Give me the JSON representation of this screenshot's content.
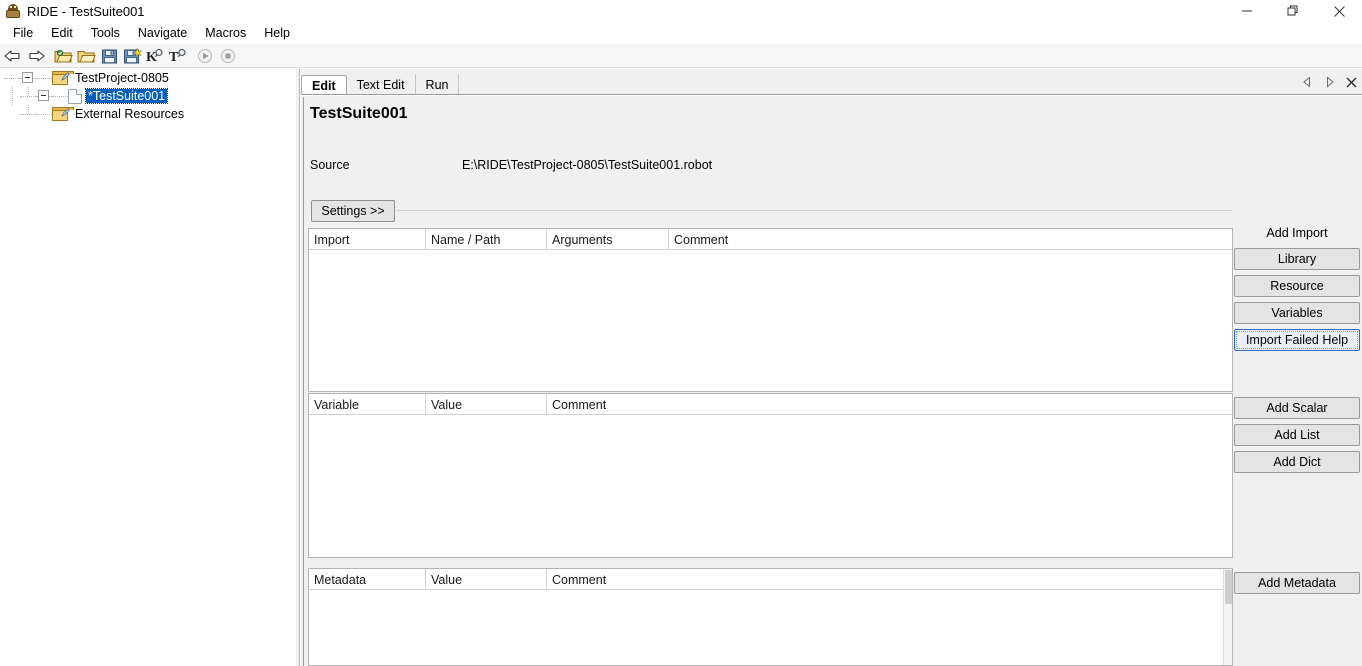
{
  "window": {
    "title": "RIDE - TestSuite001",
    "app_icon": "robot-icon",
    "controls": {
      "minimize": "minimize-icon",
      "maximize": "maximize-icon",
      "close": "close-icon"
    }
  },
  "menubar": {
    "items": [
      {
        "label": "File"
      },
      {
        "label": "Edit"
      },
      {
        "label": "Tools"
      },
      {
        "label": "Navigate"
      },
      {
        "label": "Macros"
      },
      {
        "label": "Help"
      }
    ]
  },
  "toolbar": {
    "buttons": [
      {
        "name": "back-arrow-icon",
        "title": "Go Back"
      },
      {
        "name": "forward-arrow-icon",
        "title": "Go Forward"
      },
      {
        "name": "open-project-icon",
        "title": "Open Directory"
      },
      {
        "name": "open-folder-icon",
        "title": "Open"
      },
      {
        "name": "save-icon",
        "title": "Save"
      },
      {
        "name": "save-all-icon",
        "title": "Save All"
      },
      {
        "name": "search-keyword-icon",
        "title": "Search Keywords"
      },
      {
        "name": "search-tests-icon",
        "title": "Search Tests"
      },
      {
        "name": "run-icon",
        "title": "Run"
      },
      {
        "name": "stop-icon",
        "title": "Stop"
      }
    ]
  },
  "tree": {
    "nodes": [
      {
        "label": "TestProject-0805",
        "icon": "folder-edit-icon",
        "expanded": true,
        "selected": false
      },
      {
        "label": "*TestSuite001",
        "icon": "robot-file-icon",
        "expanded": true,
        "selected": true
      },
      {
        "label": "External Resources",
        "icon": "folder-edit-icon",
        "expanded": false,
        "selected": false
      }
    ]
  },
  "editor": {
    "tabs": [
      {
        "label": "Edit",
        "active": true
      },
      {
        "label": "Text Edit",
        "active": false
      },
      {
        "label": "Run",
        "active": false
      }
    ],
    "tab_controls": [
      {
        "name": "tab-scroll-left-icon"
      },
      {
        "name": "tab-scroll-right-icon"
      },
      {
        "name": "tab-close-icon"
      }
    ],
    "suite_title": "TestSuite001",
    "source_label": "Source",
    "source_value": "E:\\RIDE\\TestProject-0805\\TestSuite001.robot",
    "settings_button": "Settings >>"
  },
  "grids": {
    "import": {
      "columns": [
        "Import",
        "Name / Path",
        "Arguments",
        "Comment"
      ],
      "rows": []
    },
    "variable": {
      "columns": [
        "Variable",
        "Value",
        "Comment"
      ],
      "rows": []
    },
    "metadata": {
      "columns": [
        "Metadata",
        "Value",
        "Comment"
      ],
      "rows": []
    }
  },
  "side_panel": {
    "add_import_label": "Add Import",
    "import_buttons": [
      {
        "label": "Library",
        "focused": false
      },
      {
        "label": "Resource",
        "focused": false
      },
      {
        "label": "Variables",
        "focused": false
      },
      {
        "label": "Import Failed Help",
        "focused": true
      }
    ],
    "variable_buttons": [
      {
        "label": "Add Scalar"
      },
      {
        "label": "Add List"
      },
      {
        "label": "Add Dict"
      }
    ],
    "metadata_buttons": [
      {
        "label": "Add Metadata"
      }
    ]
  },
  "colors": {
    "selection": "#0a5fbd",
    "focus_border": "#2f6cb5",
    "panel_bg": "#f0f0f0",
    "grid_bg": "#ffffff",
    "button_bg": "#e4e4e4"
  }
}
